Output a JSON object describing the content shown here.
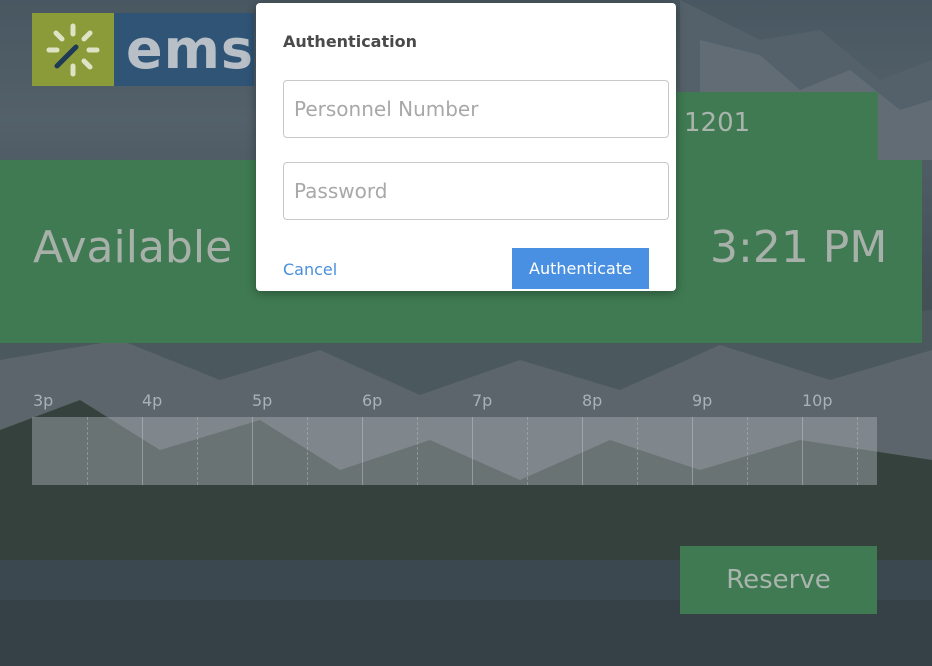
{
  "logo": {
    "text": "ems",
    "icon": "spinner-sun-icon",
    "mark_color": "#8c9b3a",
    "text_bg": "#2f5476"
  },
  "room": {
    "number": "1201"
  },
  "status": {
    "label": "Available",
    "time": "3:21 PM",
    "color": "#3f7a52"
  },
  "timeline": {
    "ticks": [
      "3p",
      "4p",
      "5p",
      "6p",
      "7p",
      "8p",
      "9p",
      "10p"
    ]
  },
  "actions": {
    "reserve_label": "Reserve"
  },
  "auth_dialog": {
    "title": "Authentication",
    "personnel_placeholder": "Personnel Number",
    "password_placeholder": "Password",
    "cancel_label": "Cancel",
    "authenticate_label": "Authenticate",
    "accent": "#4a90e2"
  }
}
